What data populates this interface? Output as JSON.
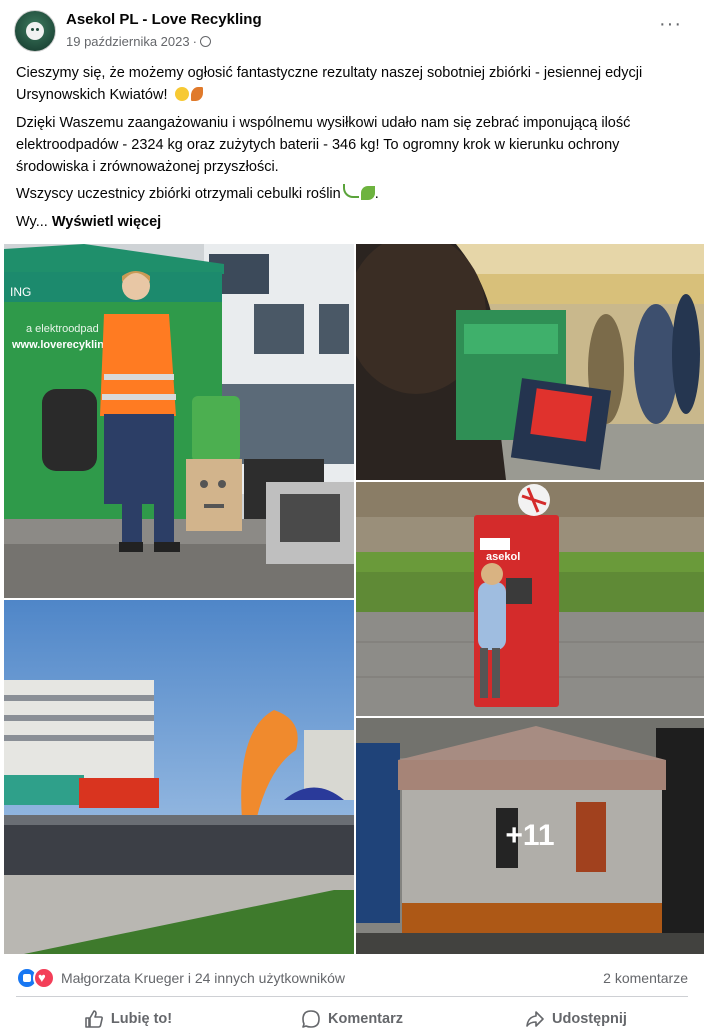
{
  "post": {
    "author": "Asekol PL - Love Recykling",
    "date": "19 października 2023",
    "meta_sep": "·",
    "more_label": "···",
    "paragraphs": {
      "p1": "Cieszymy się, że możemy ogłosić fantastyczne rezultaty naszej sobotniej zbiórki - jesiennej edycji Ursynowskich Kwiatów!",
      "p2": "Dzięki Waszemu zaangażowaniu i wspólnemu wysiłkowi udało nam się zebrać imponującą ilość elektroodpadów - 2324 kg oraz zużytych baterii - 346 kg! To ogromny krok w kierunku ochrony środowiska i zrównoważonej przyszłości.",
      "p3": "Wszyscy uczestnicy zbiórki otrzymali cebulki roślin",
      "truncated": "Wy...",
      "see_more": "Wyświetl więcej"
    }
  },
  "photos": {
    "extra_count": "+11",
    "banner_text_1": "ING",
    "banner_text_2": "a elektroodpad",
    "banner_text_3": "www.loverecykling.",
    "kiosk_brand": "asekol"
  },
  "reactions": {
    "names": "Małgorzata Krueger i 24 innych użytkowników",
    "comments": "2 komentarze"
  },
  "actions": {
    "like": "Lubię to!",
    "comment": "Komentarz",
    "share": "Udostępnij"
  },
  "colors": {
    "accent": "#1877f2",
    "heart": "#f33e58",
    "secondary_text": "#65676b"
  }
}
